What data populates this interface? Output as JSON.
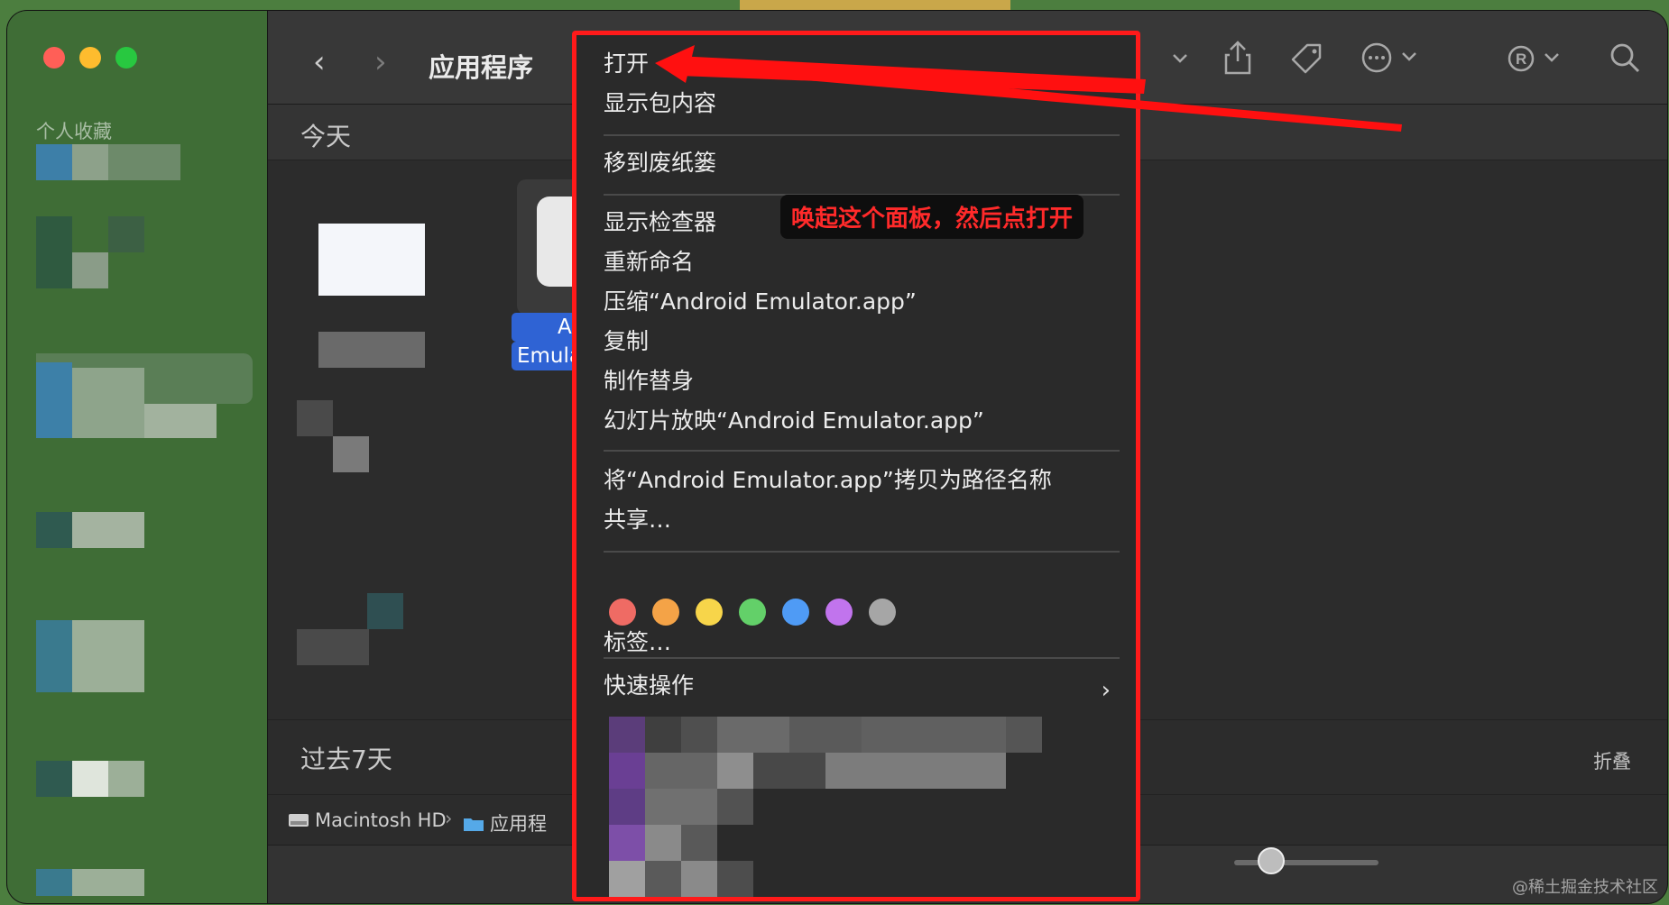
{
  "window": {
    "title": "应用程序",
    "back_icon": "‹",
    "forward_icon": "›"
  },
  "sidebar": {
    "section_label": "个人收藏"
  },
  "content": {
    "section_today": "今天",
    "section_past": "过去7天",
    "collapse_label": "折叠",
    "selected_app_label_line1": "Anc",
    "selected_app_label_line2": "Emula"
  },
  "path_bar": {
    "volume": "Macintosh HD",
    "separator": "›",
    "folder": "应用程"
  },
  "context_menu": {
    "items": [
      {
        "label": "打开"
      },
      {
        "label": "显示包内容"
      },
      {
        "label": "移到废纸篓"
      },
      {
        "label": "显示检查器"
      },
      {
        "label": "重新命名"
      },
      {
        "label": "压缩“Android Emulator.app”"
      },
      {
        "label": "复制"
      },
      {
        "label": "制作替身"
      },
      {
        "label": "幻灯片放映“Android Emulator.app”"
      },
      {
        "label": "将“Android Emulator.app”拷贝为路径名称"
      },
      {
        "label": "共享…"
      },
      {
        "label": "标签…"
      },
      {
        "label": "快速操作"
      }
    ],
    "tag_colors": [
      "#ef6b64",
      "#f4a347",
      "#f7d54a",
      "#63d069",
      "#4f9bf5",
      "#c174ed",
      "#a6a6a6"
    ],
    "submenu_arrow": "›"
  },
  "annotation": {
    "text": "唤起这个面板，然后点打开",
    "color": "#ff2a2a"
  },
  "watermark": "@稀土掘金技术社区"
}
